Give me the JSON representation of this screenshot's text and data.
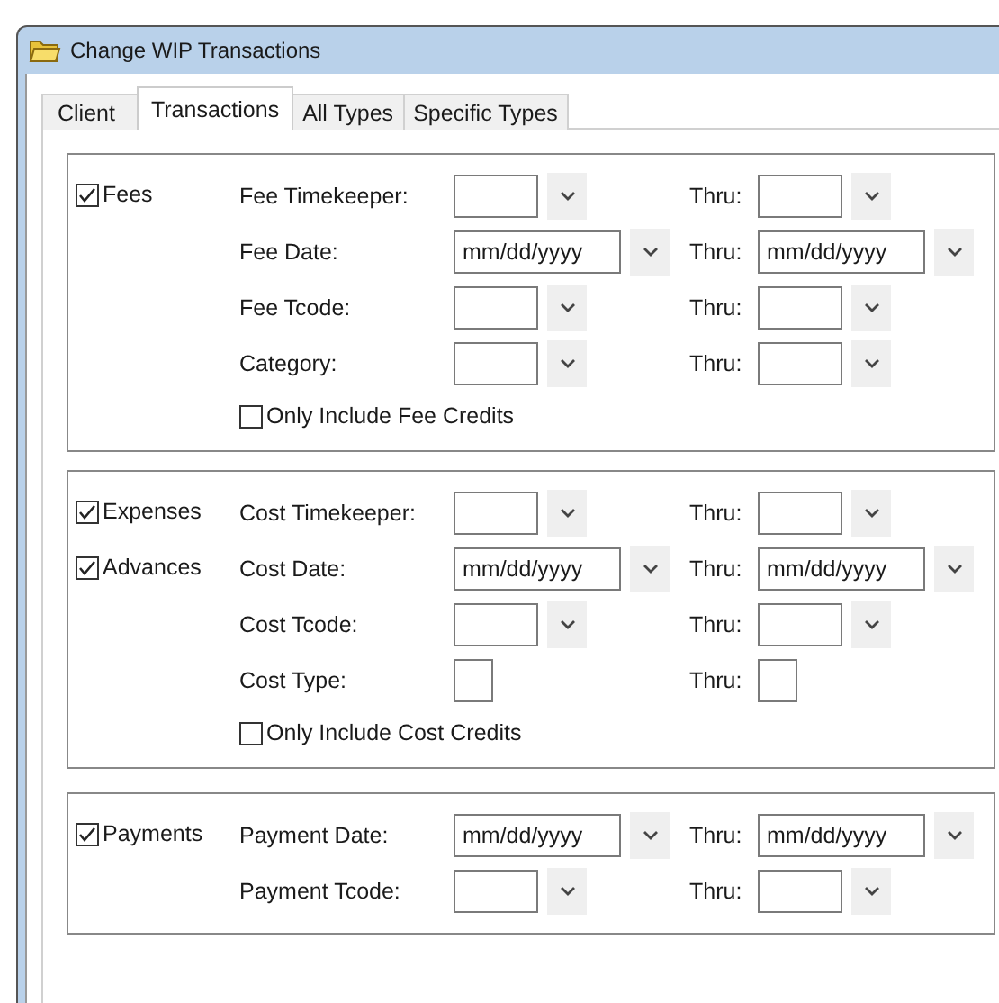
{
  "window": {
    "title": "Change WIP Transactions"
  },
  "tabs": [
    {
      "label": "Client",
      "selected": false
    },
    {
      "label": "Transactions",
      "selected": true
    },
    {
      "label": "All Types",
      "selected": false
    },
    {
      "label": "Specific Types",
      "selected": false
    }
  ],
  "groups": [
    {
      "checks": [
        {
          "label": "Fees",
          "checked": true
        }
      ],
      "rows": [
        {
          "label": "Fee Timekeeper:",
          "field": {
            "kind": "dropdown"
          },
          "thru_label": "Thru:",
          "thru_field": {
            "kind": "dropdown"
          }
        },
        {
          "label": "Fee Date:",
          "field": {
            "kind": "date",
            "value": "mm/dd/yyyy"
          },
          "thru_label": "Thru:",
          "thru_field": {
            "kind": "date",
            "value": "mm/dd/yyyy"
          }
        },
        {
          "label": "Fee Tcode:",
          "field": {
            "kind": "dropdown"
          },
          "thru_label": "Thru:",
          "thru_field": {
            "kind": "dropdown"
          }
        },
        {
          "label": "Category:",
          "field": {
            "kind": "dropdown"
          },
          "thru_label": "Thru:",
          "thru_field": {
            "kind": "dropdown"
          }
        }
      ],
      "option": {
        "label": "Only Include Fee Credits",
        "checked": false
      }
    },
    {
      "checks": [
        {
          "label": "Expenses",
          "checked": true
        },
        {
          "label": "Advances",
          "checked": true
        }
      ],
      "rows": [
        {
          "label": "Cost Timekeeper:",
          "field": {
            "kind": "dropdown"
          },
          "thru_label": "Thru:",
          "thru_field": {
            "kind": "dropdown"
          }
        },
        {
          "label": "Cost Date:",
          "field": {
            "kind": "date",
            "value": "mm/dd/yyyy"
          },
          "thru_label": "Thru:",
          "thru_field": {
            "kind": "date",
            "value": "mm/dd/yyyy"
          }
        },
        {
          "label": "Cost Tcode:",
          "field": {
            "kind": "dropdown"
          },
          "thru_label": "Thru:",
          "thru_field": {
            "kind": "dropdown"
          }
        },
        {
          "label": "Cost Type:",
          "field": {
            "kind": "text"
          },
          "thru_label": "Thru:",
          "thru_field": {
            "kind": "text"
          }
        }
      ],
      "option": {
        "label": "Only Include Cost Credits",
        "checked": false
      }
    },
    {
      "checks": [
        {
          "label": "Payments",
          "checked": true
        }
      ],
      "rows": [
        {
          "label": "Payment Date:",
          "field": {
            "kind": "date",
            "value": "mm/dd/yyyy"
          },
          "thru_label": "Thru:",
          "thru_field": {
            "kind": "date",
            "value": "mm/dd/yyyy"
          }
        },
        {
          "label": "Payment Tcode:",
          "field": {
            "kind": "dropdown"
          },
          "thru_label": "Thru:",
          "thru_field": {
            "kind": "dropdown"
          }
        }
      ]
    }
  ]
}
